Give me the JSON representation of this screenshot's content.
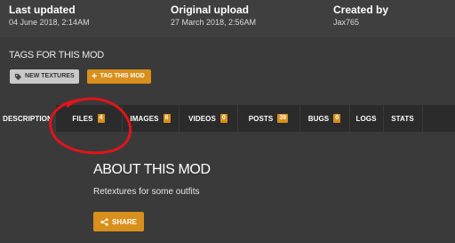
{
  "meta": {
    "last_updated_label": "Last updated",
    "last_updated_value": "04 June 2018,  2:14AM",
    "original_upload_label": "Original upload",
    "original_upload_value": "27 March 2018,  2:56AM",
    "created_by_label": "Created by",
    "created_by_value": "Jax765"
  },
  "tags": {
    "title": "TAGS FOR THIS MOD",
    "items": [
      {
        "label": "NEW TEXTURES",
        "icon": "tag-icon"
      }
    ],
    "add_button_label": "TAG THIS MOD",
    "add_icon": "plus-icon"
  },
  "tabs": [
    {
      "label": "DESCRIPTION",
      "badge": null,
      "active": true
    },
    {
      "label": "FILES",
      "badge": "4"
    },
    {
      "label": "IMAGES",
      "badge": "6"
    },
    {
      "label": "VIDEOS",
      "badge": "0"
    },
    {
      "label": "POSTS",
      "badge": "39"
    },
    {
      "label": "BUGS",
      "badge": "0"
    },
    {
      "label": "LOGS",
      "badge": null
    },
    {
      "label": "STATS",
      "badge": null
    }
  ],
  "about": {
    "title": "ABOUT THIS MOD",
    "text": "Retextures for some outfits",
    "share_label": "SHARE",
    "share_icon": "share-icon"
  },
  "colors": {
    "accent": "#d98f1b",
    "annotation": "#e0141b",
    "background": "#3a3a3a",
    "tab_bar": "#2b2b2b"
  }
}
